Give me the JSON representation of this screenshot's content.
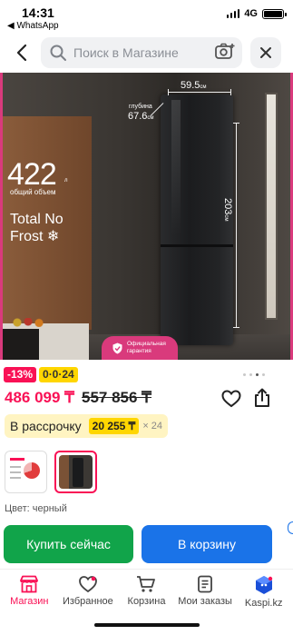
{
  "status_bar": {
    "time": "14:31",
    "back_app": "◀ WhatsApp",
    "network": "4G"
  },
  "search": {
    "placeholder": "Поиск в Магазине"
  },
  "hero": {
    "width": "59.5",
    "width_unit": "см",
    "depth_label": "глубина",
    "depth": "67.6",
    "depth_unit": "см",
    "height": "203",
    "height_unit": "см",
    "volume": "422",
    "volume_unit": "л",
    "volume_label": "общий объем",
    "feature": "Total No Frost",
    "feature_mark": "❄",
    "official_badge": "Официальная гарантия",
    "slide_count": 4,
    "active_slide": 3
  },
  "promo": {
    "discount": "-13%",
    "installment": "0·0·24"
  },
  "price": {
    "current": "486 099 ₸",
    "old": "557 856 ₸"
  },
  "installment": {
    "label": "В рассрочку",
    "amount": "20 255 ₸",
    "months": "× 24"
  },
  "color": {
    "label": "Цвет: черный"
  },
  "actions": {
    "buy_now": "Купить сейчас",
    "add_to_cart": "В корзину"
  },
  "nav": {
    "items": [
      {
        "label": "Магазин",
        "icon": "shop-icon",
        "active": true
      },
      {
        "label": "Избранное",
        "icon": "heart-icon",
        "active": false
      },
      {
        "label": "Корзина",
        "icon": "cart-icon",
        "active": false
      },
      {
        "label": "Мои заказы",
        "icon": "orders-icon",
        "active": false
      },
      {
        "label": "Kaspi.kz",
        "icon": "kaspi-icon",
        "active": false
      }
    ]
  },
  "colors": {
    "accent": "#f91155",
    "buy": "#11a44a",
    "cart": "#1a73e8",
    "installment": "#ffd600"
  }
}
